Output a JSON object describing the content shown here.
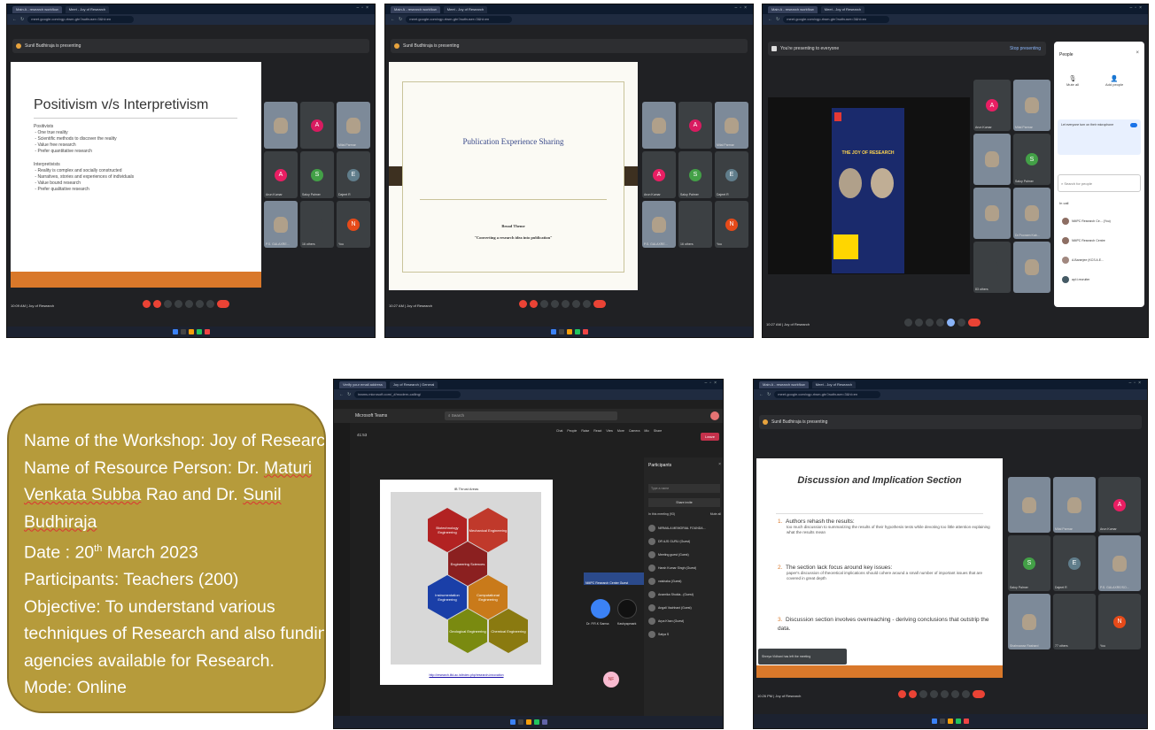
{
  "shot1": {
    "tabs": [
      "Main A - research workflow",
      "Meet - Joy of Research"
    ],
    "url": "meet.google.com/vgp-rtwm-gtn?authuser=3&hl=en",
    "presenter": "Sunil Budhiraja is presenting",
    "slide_title": "Positivism v/s Interpretivism",
    "pos_heading": "Positivists",
    "pos_items": [
      "One true reality",
      "Scientific methods to discover the reality",
      "Value free research",
      "Prefer quantitative research"
    ],
    "int_heading": "Interpretivists",
    "int_items": [
      "Reality is complex and socially constructed",
      "Narratives, stories and experiences of individuals",
      "Value bound research",
      "Prefer qualitative research"
    ],
    "tiles": [
      {
        "name": "",
        "initial": "",
        "color": "#7d8a99",
        "photo": true
      },
      {
        "name": "",
        "initial": "A",
        "color": "#d81b60",
        "photo": false
      },
      {
        "name": "Mital Parmar",
        "initial": "",
        "color": "#7d8a99",
        "photo": true
      },
      {
        "name": "Arun Kumar",
        "initial": "A",
        "color": "#e91e63",
        "photo": false
      },
      {
        "name": "Saloy Palmer",
        "initial": "S",
        "color": "#43a047",
        "photo": false
      },
      {
        "name": "Dajeet R",
        "initial": "E",
        "color": "#607d8b",
        "photo": false
      },
      {
        "name": "P.S. GALAXRE...",
        "initial": "",
        "color": "#7d8a99",
        "photo": true
      },
      {
        "name": "16 others",
        "initial": "",
        "color": "#3c4043",
        "photo": false
      },
      {
        "name": "You",
        "initial": "N",
        "color": "#e64a19",
        "photo": false
      }
    ],
    "time": "10:09 AM",
    "meeting": "Joy of Research"
  },
  "shot2": {
    "tabs": [
      "Main A - research workflow",
      "Meet - Joy of Research"
    ],
    "url": "meet.google.com/vgp-rtwm-gtn?authuser=3&hl=en",
    "presenter": "Sunil Budhiraja is presenting",
    "slide_title": "Publication Experience Sharing",
    "broad_label": "Broad Theme",
    "broad_value": "\"Converting a research idea into publication\"",
    "tiles": [
      {
        "name": "",
        "initial": "",
        "color": "#7d8a99",
        "photo": true
      },
      {
        "name": "",
        "initial": "A",
        "color": "#d81b60",
        "photo": false
      },
      {
        "name": "Mital Parmar",
        "initial": "",
        "color": "#7d8a99",
        "photo": true
      },
      {
        "name": "Arun Kumar",
        "initial": "A",
        "color": "#e91e63",
        "photo": false
      },
      {
        "name": "Saloy Palmer",
        "initial": "S",
        "color": "#43a047",
        "photo": false
      },
      {
        "name": "Dajeet R",
        "initial": "E",
        "color": "#607d8b",
        "photo": false
      },
      {
        "name": "P.S. GALAXRE...",
        "initial": "",
        "color": "#7d8a99",
        "photo": true
      },
      {
        "name": "16 others",
        "initial": "",
        "color": "#3c4043",
        "photo": false
      },
      {
        "name": "You",
        "initial": "N",
        "color": "#e64a19",
        "photo": false
      }
    ],
    "time": "10:27 AM",
    "meeting": "Joy of Research"
  },
  "shot3": {
    "tabs": [
      "Main A - research workflow",
      "Meet - Joy of Research"
    ],
    "url": "meet.google.com/vgp-rtwm-gtn?authuser=3&hl=en",
    "presenting_bar": "You're presenting to everyone",
    "stop_label": "Stop presenting",
    "poster_title": "THE JOY OF RESEARCH",
    "tiles": [
      {
        "name": "Arun Kumar",
        "initial": "A",
        "color": "#e91e63",
        "photo": false
      },
      {
        "name": "Mital Parmar",
        "initial": "",
        "color": "#7d8a99",
        "photo": true
      },
      {
        "name": "",
        "initial": "",
        "color": "#7d8a99",
        "photo": true
      },
      {
        "name": "Saloy Palmer",
        "initial": "S",
        "color": "#43a047",
        "photo": false
      },
      {
        "name": "",
        "initial": "",
        "color": "#7d8a99",
        "photo": true
      },
      {
        "name": "Dr.Poonam Kab...",
        "initial": "",
        "color": "#7d8a99",
        "photo": true
      },
      {
        "name": "83 others",
        "initial": "",
        "color": "#3c4043",
        "photo": false
      },
      {
        "name": "",
        "initial": "",
        "color": "#7d8a99",
        "photo": true
      }
    ],
    "people_title": "People",
    "add_people": "Add people",
    "mute_all": "Mute all",
    "mic_note": "Let everyone turn on their microphone",
    "search_placeholder": "Search for people",
    "in_call": "In call",
    "people": [
      "NMPC Research Ce... (You)",
      "NMPC Research Centre",
      "A.Banerjee (KCS A.E...",
      "apl.t.recruiter"
    ],
    "time": "10:27 AM",
    "meeting": "Joy of Research"
  },
  "info": {
    "l1": "Name of the Workshop: Joy of Research",
    "l2a": "Name of Resource Person: Dr. ",
    "l2b": "Maturi",
    "l3a": "Venkata Subba",
    "l3b": " Rao and Dr. ",
    "l3c": "Sunil",
    "l4": "Budhiraja",
    "l5a": "Date : 20",
    "l5sup": "th",
    "l5b": " March 2023",
    "l6": "Participants: Teachers (200)",
    "l7": "Objective: To understand various",
    "l8": "techniques of Research and also funding",
    "l9": "agencies available for Research.",
    "l10": "Mode: Online"
  },
  "shot4": {
    "tabs": [
      "Verify your email address",
      "Joy of Research | General"
    ],
    "url": "teams.microsoft.com/_#/modern-calling/",
    "app": "Microsoft Teams",
    "search": "Search",
    "timer": "41:53",
    "toolbar": [
      "Chat",
      "People",
      "Raise",
      "React",
      "View",
      "More",
      "Camera",
      "Mic",
      "Share"
    ],
    "leave": "Leave",
    "participants_title": "Participants",
    "type_name": "Type a name",
    "share_invite": "Share invite",
    "in_meeting": "In this meeting (93)",
    "mute_all": "Mute all",
    "people": [
      "NIRMALA MEMORIAL FOUNDA...",
      "DR AJS GURU (Guest)",
      "Meeting guest (Guest)",
      "Harsh Kumar Singh (Guest)",
      "vaishaka (Guest)",
      "Anamika Shukla...(Guest)",
      "Angali Vachhani (Guest)",
      "Arpa Khan (Guest)",
      "Satya S"
    ],
    "hex_title": "IB Thrust Areas",
    "hexes": [
      "Biotechnology Engineering",
      "Mechanical Engineering",
      "Engineering Sciences",
      "Instrumentation Engineering",
      "Computational Engineering",
      "Geological Engineering",
      "Chemical Engineering"
    ],
    "link": "http://research.iitd.ac.in/index.php/research-innovation",
    "caption": "NMPC Research Center Guest",
    "avatar_nf": "NF",
    "tile_name": "Dr. P.R.K Sarma",
    "tile_name2": "Kashyapmark"
  },
  "shot5": {
    "tabs": [
      "Main A - research workflow",
      "Meet - Joy of Research"
    ],
    "url": "meet.google.com/vgp-rtwm-gtn?authuser=3&hl=en",
    "presenter": "Sunil Budhiraja is presenting",
    "slide_title": "Discussion and Implication Section",
    "points": [
      {
        "n": "1.",
        "head": "Authors rehash the results:",
        "body": "too much discussion to summarizing the results of their hypothesis tests while devoting too little attention explaining what the results mean"
      },
      {
        "n": "2.",
        "head": "The section lack focus around key issues:",
        "body": "paper's discussion of theoretical implications should cohere around a small number of important issues that are covered in great depth"
      },
      {
        "n": "3.",
        "head": "Discussion section involves overreaching - deriving conclusions that outstrip the data.",
        "body": ""
      }
    ],
    "toast": "Shreya Vidhani has left the meeting",
    "tiles": [
      {
        "name": "",
        "initial": "",
        "color": "#7d8a99",
        "photo": true
      },
      {
        "name": "Mital Parmar",
        "initial": "",
        "color": "#7d8a99",
        "photo": true
      },
      {
        "name": "Arun Kumar",
        "initial": "A",
        "color": "#e91e63",
        "photo": false
      },
      {
        "name": "Saloy Palmer",
        "initial": "S",
        "color": "#43a047",
        "photo": false
      },
      {
        "name": "Dajeet R",
        "initial": "E",
        "color": "#607d8b",
        "photo": false
      },
      {
        "name": "P.S. GALAXRE/SO...",
        "initial": "",
        "color": "#7d8a99",
        "photo": true
      },
      {
        "name": "Shahnawaz Rashard",
        "initial": "",
        "color": "#7d8a99",
        "photo": true
      },
      {
        "name": "77 others",
        "initial": "",
        "color": "#3c4043",
        "photo": false
      },
      {
        "name": "You",
        "initial": "N",
        "color": "#e64a19",
        "photo": false
      }
    ],
    "time": "10:26 PM",
    "meeting": "Joy of Research"
  }
}
